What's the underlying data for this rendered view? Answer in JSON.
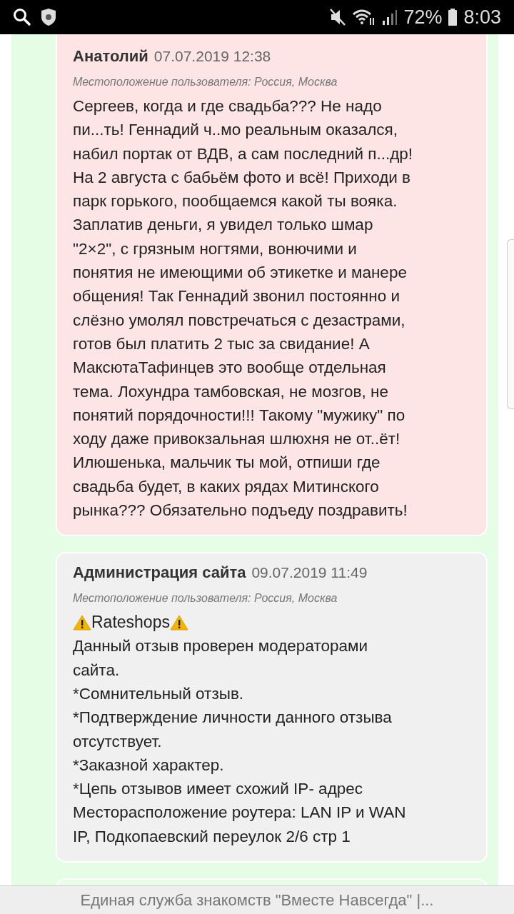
{
  "status_bar": {
    "battery": "72%",
    "time": "8:03"
  },
  "comments": [
    {
      "kind": "flagged",
      "author": "Анатолий",
      "date": "07.07.2019 12:38",
      "location": "Местоположение пользователя: Россия, Москва",
      "text": "Сергеев, когда и где свадьба??? Не надо\nпи...ть! Геннадий ч..мо реальным оказался,\nнабил портак от ВДВ, а сам последний п...др!\nНа 2 августа с бабьём фото и всё! Приходи в\nпарк горького, пообщаемся какой ты вояка.\nЗаплатив деньги, я увидел только шмар\n\"2×2\", с грязным ногтями, вонючими и\nпонятия не имеющими об этикетке и манере\nобщения! Так Геннадий звонил постоянно и\nслёзно умолял повстречаться с дезастрами,\nготов был платить 2 тыс за свидание! А\nМаксютаТафинцев это вообще отдельная\nтема. Лохундра тамбовская, не мозгов, не\nпонятий порядочности!!! Такому \"мужику\" по\nходу даже привокзальная шлюхня не от..ёт!\nИлюшенька, мальчик ты мой, отпиши где\nсвадьба будет, в каких рядах Митинского\nрынка??? Обязательно подъеду поздравить!"
    },
    {
      "kind": "admin",
      "author": "Администрация сайта",
      "date": "09.07.2019 11:49",
      "location": "Местоположение пользователя: Россия, Москва",
      "badge": "Rateshops",
      "text": "Данный отзыв проверен модераторами\nсайта.\n*Сомнительный отзыв.\n*Подтверждение личности данного отзыва\nотсутствует.\n*Заказной характер.\n*Цепь отзывов имеет схожий   IP- адрес\nМесторасположение роутера: LAN IP и WAN\nIP, Подкопаевский переулок 2/6 стр 1"
    }
  ],
  "page_title": "Единая служба знакомств \"Вместе Навсегда\" |..."
}
